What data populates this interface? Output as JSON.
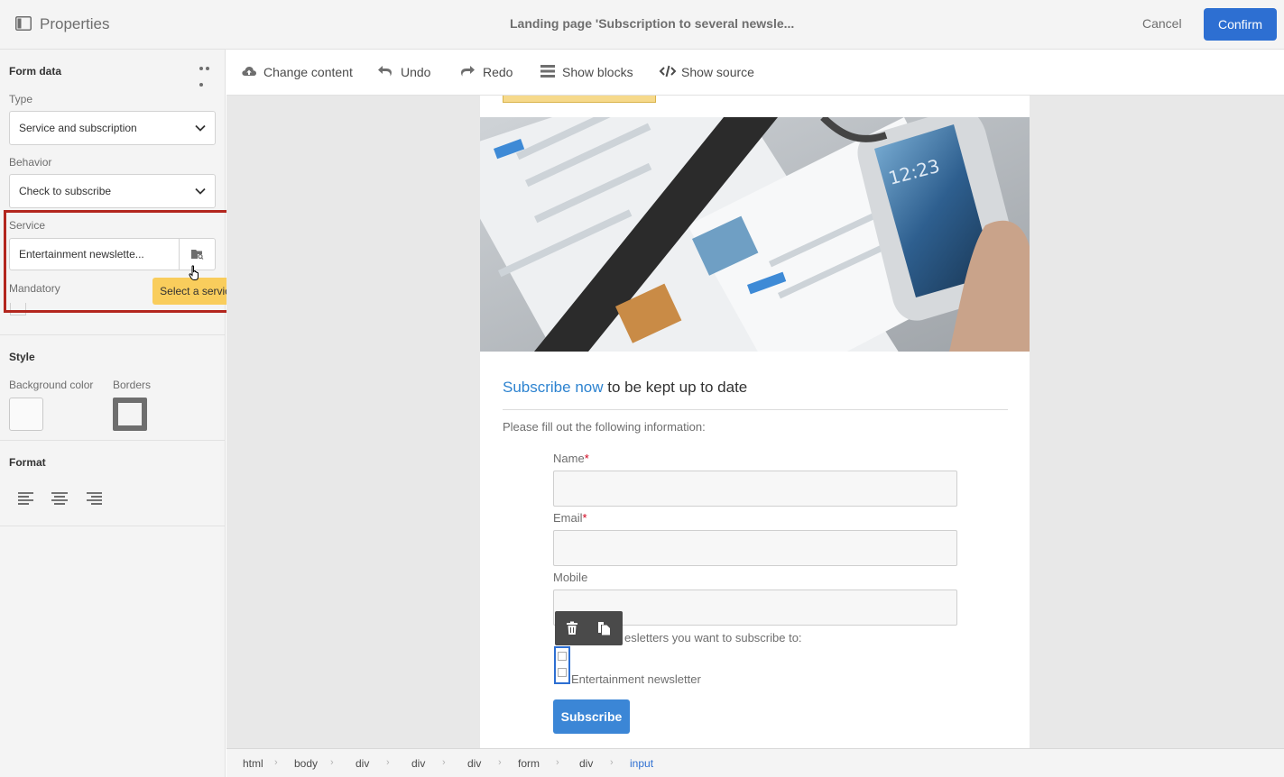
{
  "topbar": {
    "title": "Properties",
    "page_name": "Landing page 'Subscription to several newsle...",
    "cancel_label": "Cancel",
    "confirm_label": "Confirm",
    "accent_color": "#2d6fd2"
  },
  "left_panel": {
    "form_data_title": "Form data",
    "type": {
      "label": "Type",
      "value": "Service and subscription"
    },
    "behavior": {
      "label": "Behavior",
      "value": "Check to subscribe"
    },
    "service": {
      "label": "Service",
      "value": "Entertainment newslette...",
      "tooltip": "Select a service"
    },
    "mandatory": {
      "label": "Mandatory",
      "checked": false
    },
    "style_title": "Style",
    "background_color_label": "Background color",
    "borders_label": "Borders",
    "format_title": "Format",
    "highlight_color": "#b3261e"
  },
  "toolbar": {
    "change_content": "Change content",
    "undo": "Undo",
    "redo": "Redo",
    "show_blocks": "Show blocks",
    "show_source": "Show source"
  },
  "page": {
    "headline_accent": "Subscribe now",
    "headline_rest": " to be kept up to date",
    "fill_text": "Please fill out the following information:",
    "name_label": "Name",
    "email_label": "Email",
    "mobile_label": "Mobile",
    "required_mark": "*",
    "newsletter_question": "esletters you want to subscribe to:",
    "newsletter_option": "Entertainment newsletter",
    "subscribe_label": "Subscribe"
  },
  "breadcrumb": [
    "html",
    "body",
    "div",
    "div",
    "div",
    "form",
    "div",
    "input"
  ]
}
